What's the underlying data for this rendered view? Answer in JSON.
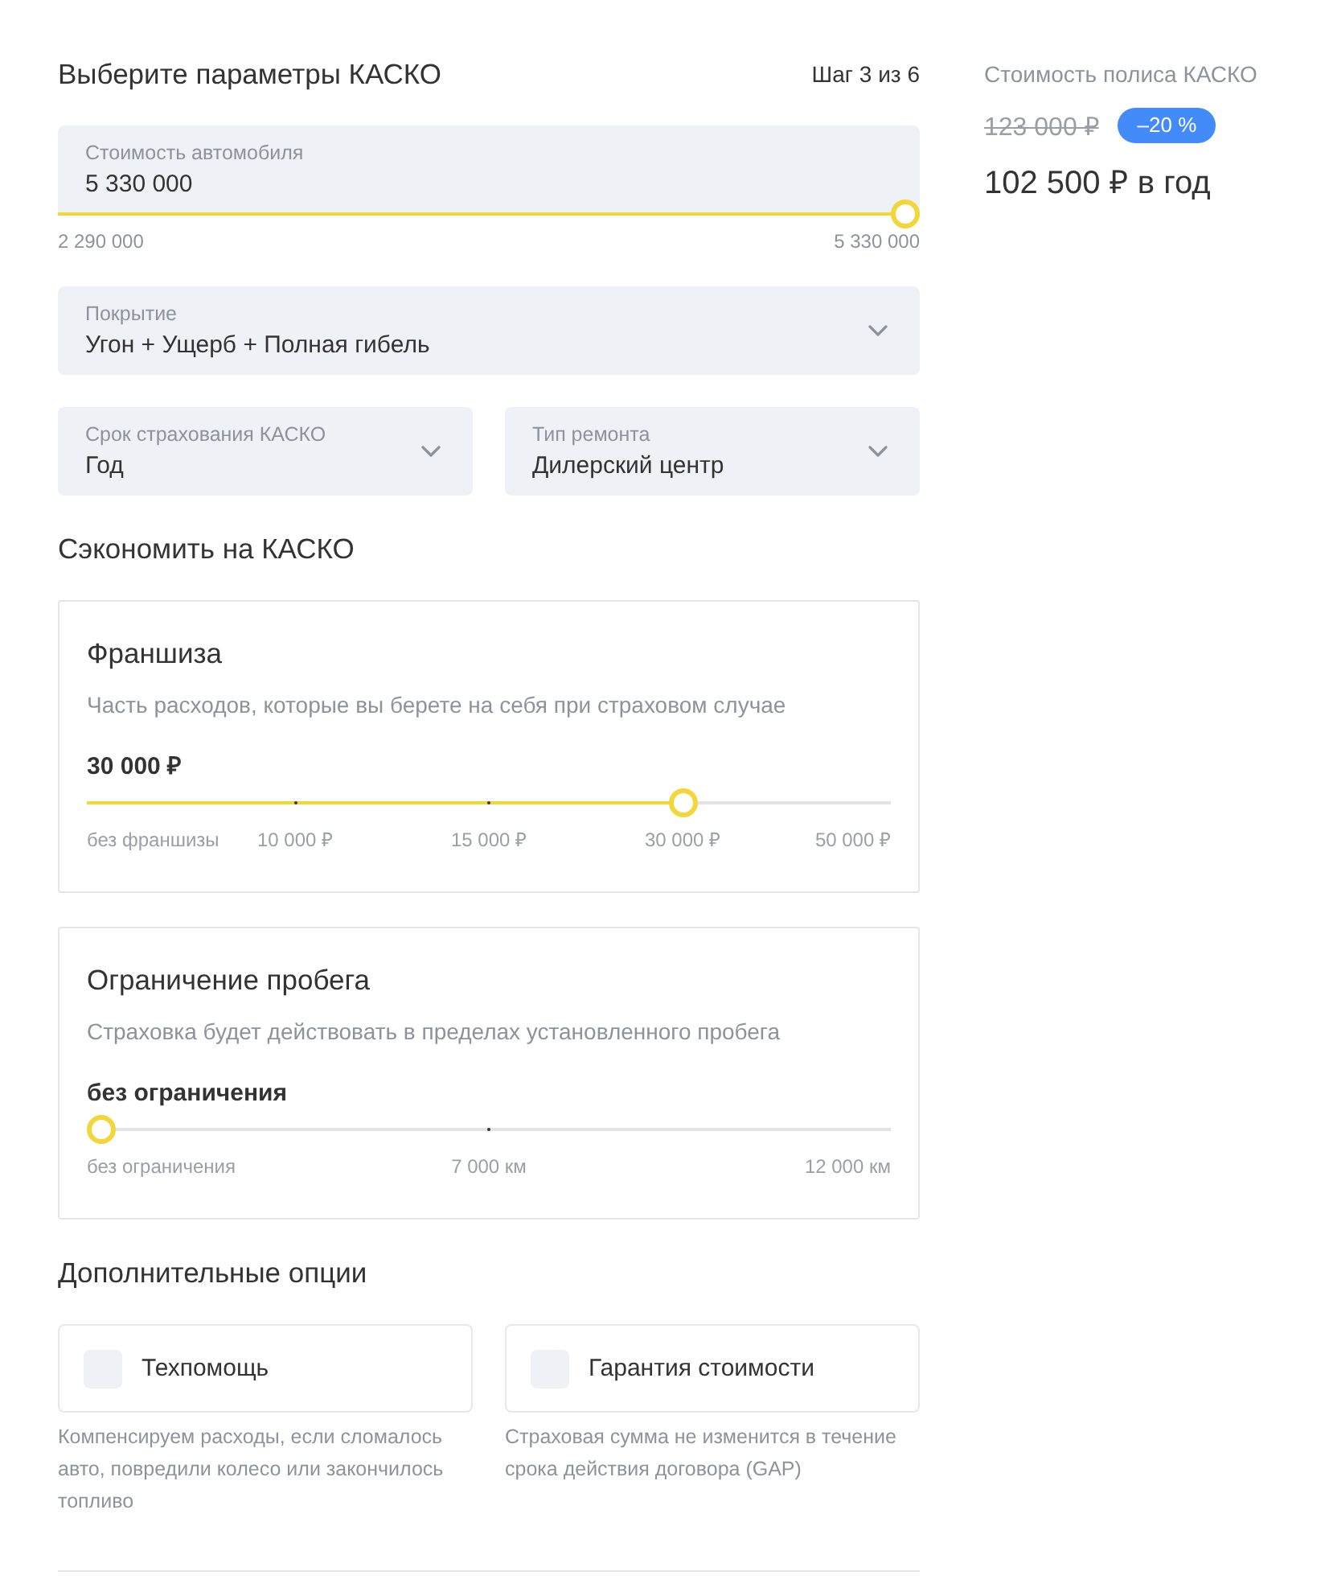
{
  "header": {
    "title": "Выберите параметры КАСКО",
    "step": "Шаг 3 из 6"
  },
  "car_value": {
    "label": "Стоимость автомобиля",
    "value": "5 330 000",
    "level": 1,
    "min": "2 290 000",
    "max": "5 330 000"
  },
  "select_rows": [
    [
      {
        "label": "Покрытие",
        "value": "Угон + Ущерб + Полная гибель"
      }
    ],
    [
      {
        "label": "Срок страхования КАСКО",
        "value": "Год"
      },
      {
        "label": "Тип ремонта",
        "value": "Дилерский центр"
      }
    ]
  ],
  "savings": {
    "title": "Сэкономить на КАСКО",
    "cards": [
      {
        "title": "Франшиза",
        "description": "Часть расходов, которые вы берете на себя при страховом случае",
        "value": "30 000 ₽",
        "level": 0.75,
        "ticks": [
          "без франшизы",
          "10 000 ₽",
          "15 000 ₽",
          "30 000 ₽",
          "50 000 ₽"
        ]
      },
      {
        "title": "Ограничение пробега",
        "description": "Страховка будет действовать в пределах установленного пробега",
        "value": "без ограничения",
        "level": 0,
        "ticks": [
          "без ограничения",
          "7 000 км",
          "12 000 км"
        ]
      }
    ]
  },
  "options": {
    "title": "Дополнительные опции",
    "items": [
      {
        "label": "Техпомощь",
        "checked": false,
        "description": "Компенсируем расходы, если сломалось авто, повредили колесо или закончилось топливо"
      },
      {
        "label": "Гарантия стоимости",
        "checked": false,
        "description": "Страховая сумма не изменится в течение срока действия договора (GAP)"
      }
    ]
  },
  "summary": {
    "title": "Стоимость полиса КАСКО",
    "old_price": "123 000 ₽",
    "discount": "–20 %",
    "price": "102 500 ₽ в год"
  }
}
